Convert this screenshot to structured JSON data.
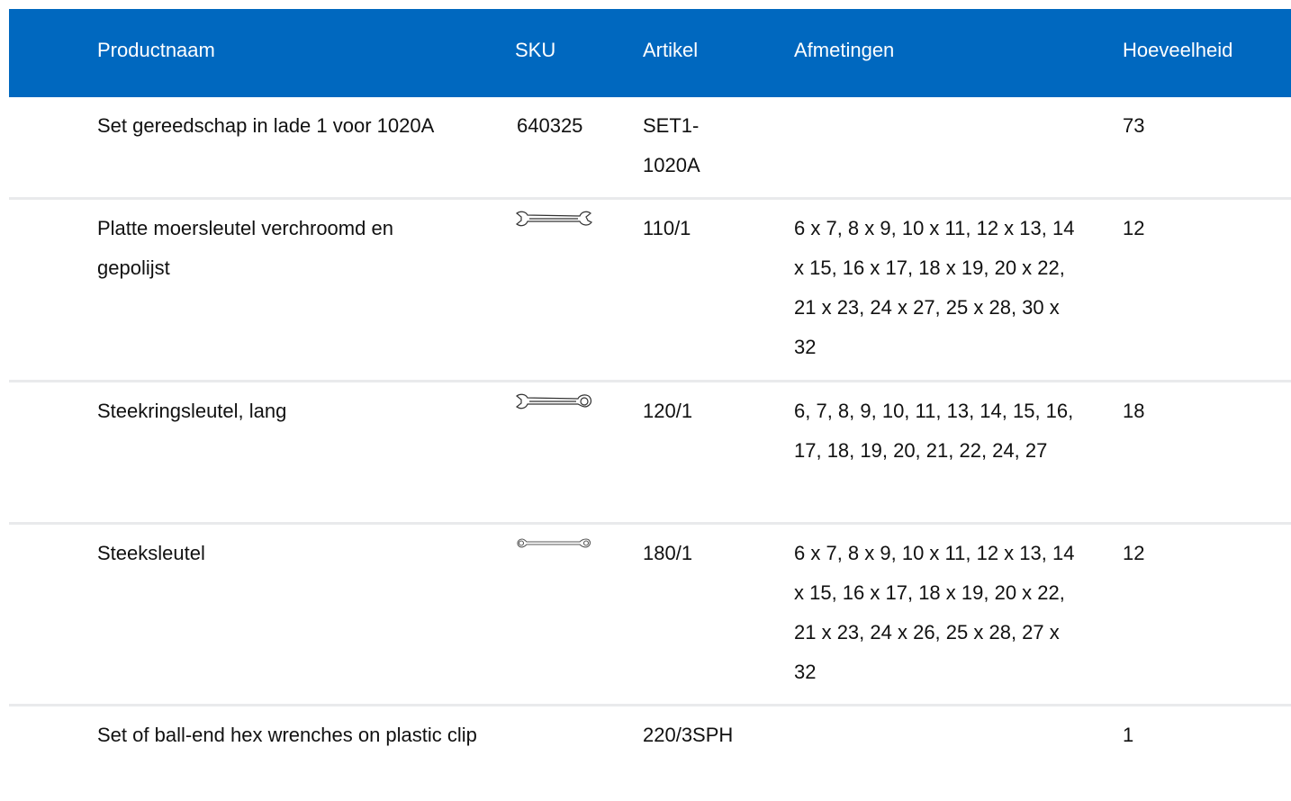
{
  "table": {
    "headers": {
      "name": "Productnaam",
      "sku": "SKU",
      "article": "Artikel",
      "dimensions": "Afmetingen",
      "quantity": "Hoeveelheid"
    },
    "rows": [
      {
        "name": "Set gereedschap in lade 1 voor 1020A",
        "sku": "640325",
        "sku_icon": "",
        "article": "SET1-1020A",
        "dimensions": "",
        "quantity": "73"
      },
      {
        "name": "Platte moersleutel verchroomd en gepolijst",
        "sku": "",
        "sku_icon": "open-end-wrench-icon",
        "article": "110/1",
        "dimensions": "6 x 7, 8 x 9, 10 x 11, 12 x 13, 14 x 15, 16 x 17, 18 x 19, 20 x 22, 21 x 23, 24 x 27, 25 x 28, 30 x 32",
        "quantity": "12"
      },
      {
        "name": "Steekringsleutel, lang",
        "sku": "",
        "sku_icon": "combination-wrench-icon",
        "article": "120/1",
        "dimensions": "6, 7, 8, 9, 10, 11, 13, 14, 15, 16, 17, 18, 19, 20, 21, 22, 24, 27",
        "quantity": "18"
      },
      {
        "name": "Steeksleutel",
        "sku": "",
        "sku_icon": "double-ring-wrench-icon",
        "article": "180/1",
        "dimensions": "6 x 7, 8 x 9, 10 x 11, 12 x 13, 14 x 15, 16 x 17, 18 x 19, 20 x 22, 21 x 23, 24 x 26, 25 x 28, 27 x 32",
        "quantity": "12"
      },
      {
        "name": "Set of ball-end hex wrenches on plastic clip",
        "sku": "",
        "sku_icon": "",
        "article": "220/3SPH",
        "dimensions": "",
        "quantity": "1"
      }
    ]
  },
  "colors": {
    "header_bg": "#0068bf",
    "header_text": "#ffffff",
    "row_divider": "#e9eaec"
  }
}
